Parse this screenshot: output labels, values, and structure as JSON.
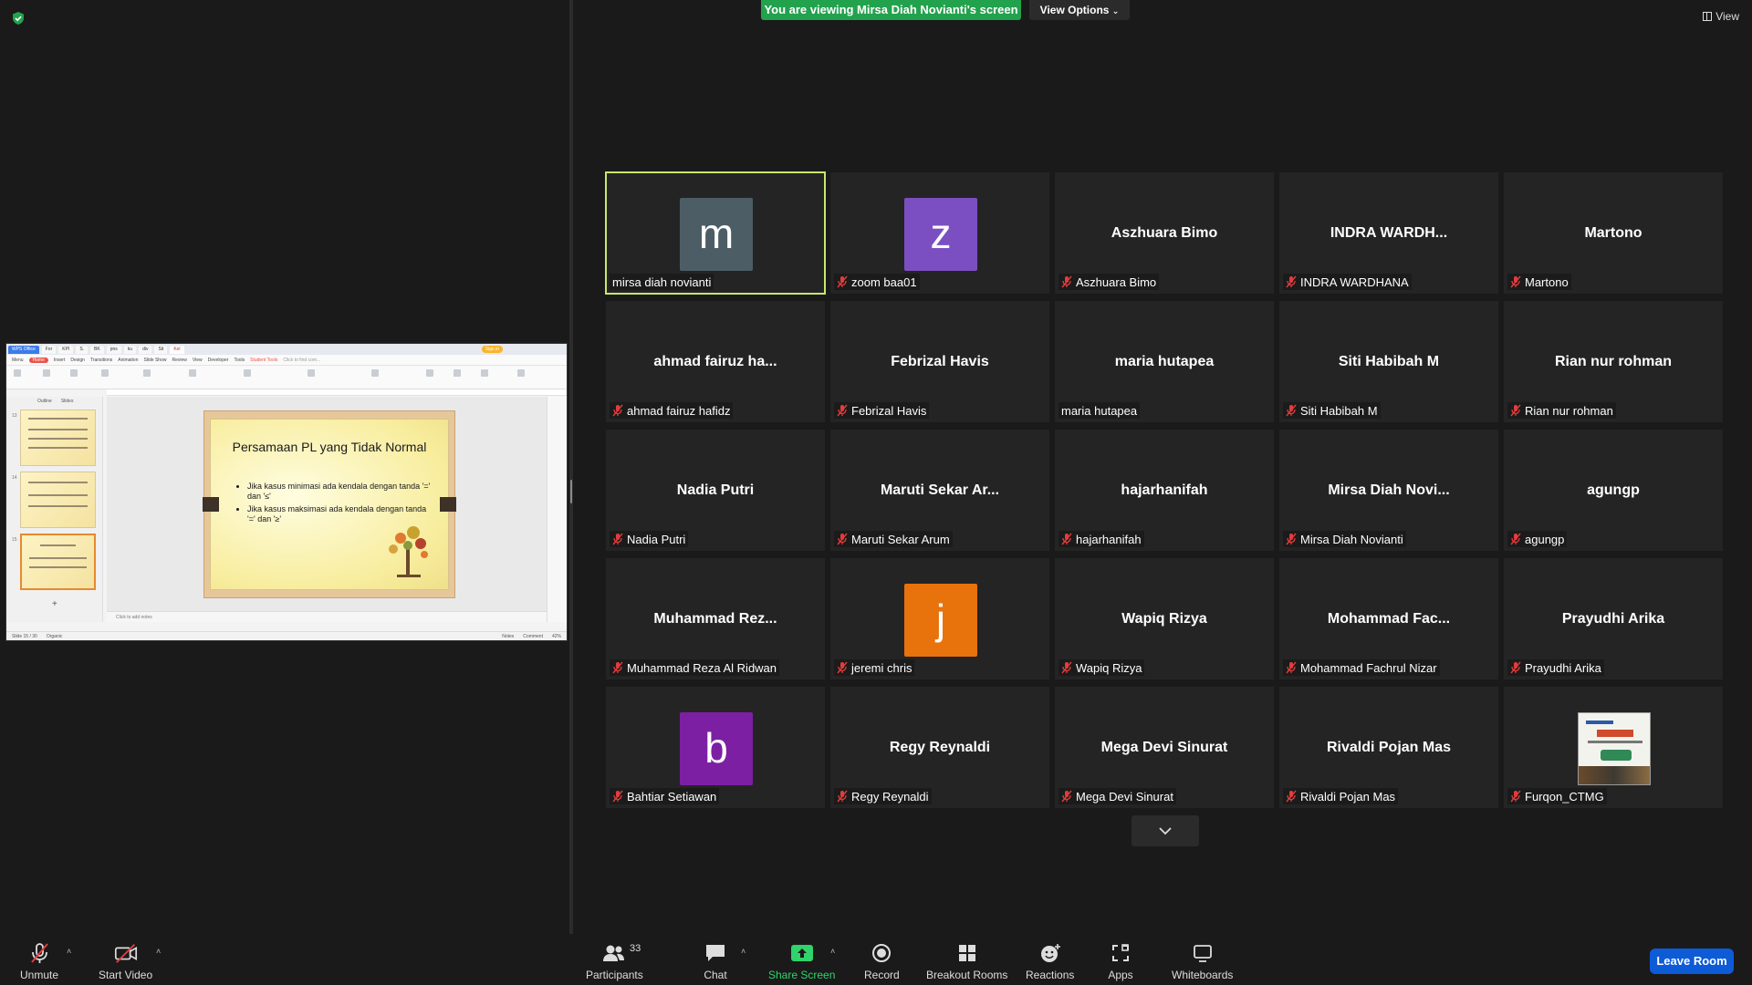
{
  "banner": {
    "text": "You are viewing Mirsa Diah Novianti's screen"
  },
  "view_options": {
    "label": "View Options"
  },
  "view": {
    "label": "View"
  },
  "shared_screen": {
    "tabs": [
      "WPS Office",
      "For",
      "KPI",
      "S.",
      "BK",
      "pns",
      "ku",
      "div",
      "Sit",
      "Kel"
    ],
    "sign_in": "Sign in",
    "menu": [
      "Menu",
      "Home",
      "Insert",
      "Design",
      "Transitions",
      "Animation",
      "Slide Show",
      "Review",
      "View",
      "Developer",
      "Tools",
      "Student Tools",
      "Click to find com..."
    ],
    "side_tabs": [
      "Outline",
      "Slides"
    ],
    "thumb_numbers": [
      "13",
      "14",
      "15"
    ],
    "slide": {
      "title": "Persamaan PL yang Tidak Normal",
      "bullets": [
        "Jika kasus minimasi ada kendala dengan tanda '=' dan '≤'",
        "Jika kasus maksimasi ada kendala dengan tanda '=' dan '≥'"
      ]
    },
    "notes": "Click to add notes",
    "status_left": "Slide 15 / 30",
    "status_theme": "Organic",
    "status_right": [
      "Notes",
      "Comment",
      "42%"
    ]
  },
  "participants": [
    {
      "big": "",
      "avatar": "m",
      "avatar_color": "#4d5d66",
      "label": "mirsa diah novianti",
      "muted": false,
      "active": true
    },
    {
      "big": "",
      "avatar": "z",
      "avatar_color": "#7b4fc2",
      "label": "zoom baa01",
      "muted": true
    },
    {
      "big": "Aszhuara Bimo",
      "label": "Aszhuara Bimo",
      "muted": true
    },
    {
      "big": "INDRA  WARDH...",
      "label": "INDRA WARDHANA",
      "muted": true
    },
    {
      "big": "Martono",
      "label": "Martono",
      "muted": true
    },
    {
      "big": "ahmad  fairuz  ha...",
      "label": "ahmad fairuz hafidz",
      "muted": true
    },
    {
      "big": "Febrizal Havis",
      "label": "Febrizal Havis",
      "muted": true
    },
    {
      "big": "maria hutapea",
      "label": "maria hutapea",
      "muted": false
    },
    {
      "big": "Siti Habibah M",
      "label": "Siti Habibah M",
      "muted": true
    },
    {
      "big": "Rian nur rohman",
      "label": "Rian nur rohman",
      "muted": true
    },
    {
      "big": "Nadia Putri",
      "label": "Nadia Putri",
      "muted": true
    },
    {
      "big": "Maruti  Sekar  Ar...",
      "label": "Maruti Sekar Arum",
      "muted": true
    },
    {
      "big": "hajarhanifah",
      "label": "hajarhanifah",
      "muted": true
    },
    {
      "big": "Mirsa  Diah  Novi...",
      "label": "Mirsa Diah Novianti",
      "muted": true
    },
    {
      "big": "agungp",
      "label": "agungp",
      "muted": true
    },
    {
      "big": "Muhammad  Rez...",
      "label": "Muhammad Reza Al Ridwan",
      "muted": true
    },
    {
      "big": "",
      "avatar": "j",
      "avatar_color": "#e8720c",
      "label": "jeremi chris",
      "muted": true
    },
    {
      "big": "Wapiq Rizya",
      "label": "Wapiq Rizya",
      "muted": true
    },
    {
      "big": "Mohammad  Fac...",
      "label": "Mohammad Fachrul Nizar",
      "muted": true
    },
    {
      "big": "Prayudhi Arika",
      "label": "Prayudhi Arika",
      "muted": true
    },
    {
      "big": "",
      "avatar": "b",
      "avatar_color": "#7d1fa3",
      "label": "Bahtiar Setiawan",
      "muted": true
    },
    {
      "big": "Regy Reynaldi",
      "label": "Regy Reynaldi",
      "muted": true
    },
    {
      "big": "Mega Devi Sinurat",
      "label": "Mega Devi Sinurat",
      "muted": true
    },
    {
      "big": "Rivaldi Pojan Mas",
      "label": "Rivaldi Pojan Mas",
      "muted": true
    },
    {
      "big": "",
      "poster": true,
      "label": "Furqon_CTMG",
      "muted": true
    }
  ],
  "toolbar": {
    "unmute": "Unmute",
    "start_video": "Start Video",
    "participants": "Participants",
    "participants_count": "33",
    "chat": "Chat",
    "share_screen": "Share Screen",
    "record": "Record",
    "breakout_rooms": "Breakout Rooms",
    "reactions": "Reactions",
    "apps": "Apps",
    "whiteboards": "Whiteboards",
    "leave_room": "Leave Room"
  }
}
